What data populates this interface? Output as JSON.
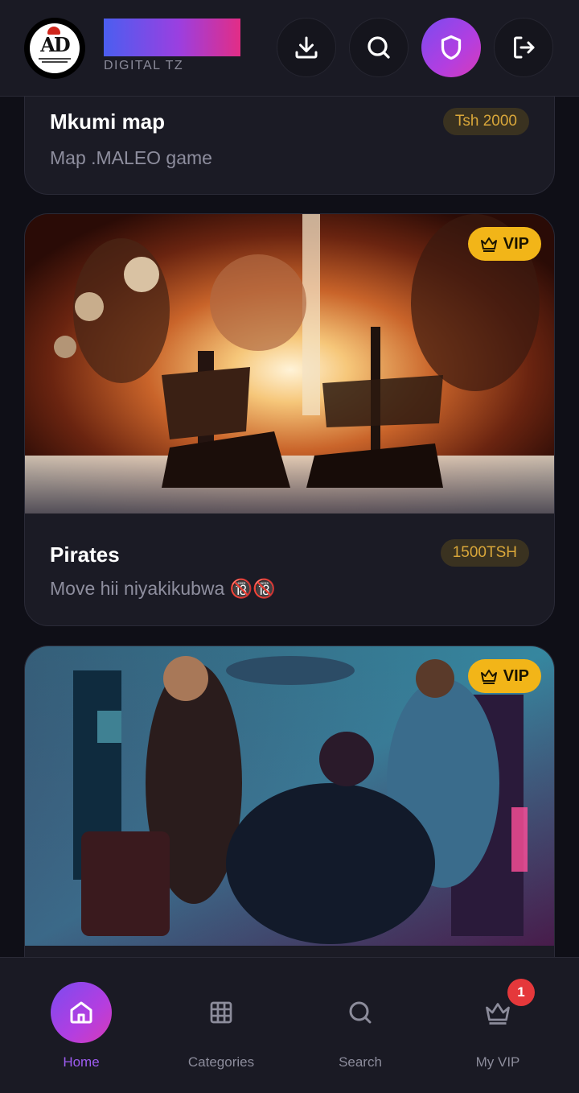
{
  "header": {
    "brand_subtitle": "DIGITAL TZ",
    "logo_text": "AD",
    "buttons": [
      {
        "name": "download",
        "icon": "download-icon"
      },
      {
        "name": "search",
        "icon": "search-icon"
      },
      {
        "name": "shield",
        "icon": "shield-icon"
      },
      {
        "name": "logout",
        "icon": "logout-icon"
      }
    ],
    "colors": {
      "accent_start": "#7b4bf0",
      "accent_end": "#d73bb8"
    }
  },
  "cards": [
    {
      "title": "Mkumi map",
      "description": "Map .MALEO game",
      "price": "Tsh 2000"
    },
    {
      "title": "Pirates",
      "description": "Move hii niyakikubwa 🔞🔞",
      "price": "1500TSH",
      "badge": "VIP"
    },
    {
      "badge": "VIP"
    }
  ],
  "bottom_nav": {
    "items": [
      {
        "label": "Home",
        "icon": "home-icon",
        "active": true
      },
      {
        "label": "Categories",
        "icon": "grid-icon"
      },
      {
        "label": "Search",
        "icon": "search-icon"
      },
      {
        "label": "My VIP",
        "icon": "crown-icon",
        "badge": "1"
      }
    ]
  }
}
